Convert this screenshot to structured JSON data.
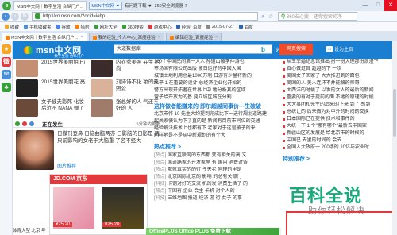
{
  "window": {
    "active_tab_title": "MSN中文网｜数字生活 合纵门户...",
    "badge": "MSN中文网 ▼",
    "menu_link": "有问题下载 ▼",
    "browser_name": "360安全浏览器 7",
    "controls": [
      "—",
      "□",
      "✕"
    ]
  },
  "addressbar": {
    "url": "http://cn.msn.com/?ocid=iehp",
    "search_placeholder": "360安心搜，还你搜索纯净"
  },
  "favorites": [
    {
      "label": "收藏",
      "color": "#f5a623"
    },
    {
      "label": "手机收藏夹",
      "color": "#4a90d9"
    },
    {
      "label": "谷歌",
      "color": "#4285f4"
    },
    {
      "label": "猎豹",
      "color": "#ff7d00"
    },
    {
      "label": "网址大全",
      "color": "#35a035"
    },
    {
      "label": "360搜索",
      "color": "#35a035"
    },
    {
      "label": "游戏中心",
      "color": "#e4393c"
    },
    {
      "label": "经验_百度",
      "color": "#2a63b8"
    },
    {
      "label": "2015-07-27",
      "color": "#888888"
    },
    {
      "label": "百度",
      "color": "#2a63b8"
    }
  ],
  "tabs": [
    {
      "label": "MSN中文网｜数字生活 合纵门户...",
      "active": true
    },
    {
      "label": "我的经验_个人中心_百度经验",
      "active": false
    },
    {
      "label": "编辑经验_百度经验",
      "active": false
    }
  ],
  "msn": {
    "logo": "msn中文网",
    "tagline": "数字生活·合纵门户",
    "search_value": "大道数据库",
    "bing_icon": "b",
    "search_label": "必应",
    "web_search": "网页搜索",
    "homepage": "设为主页"
  },
  "photo_cards": [
    {
      "caption": "2015世界美丽姐,Hi",
      "color": "#c58f74"
    },
    {
      "caption": "内衣秀美照 在生 时尚",
      "color": "#3b2b2b"
    },
    {
      "caption": "2015世界美丽花 亮",
      "color": "#222222"
    },
    {
      "caption": "刘诗诗不化 妆的美照公",
      "color": "#d8b39a"
    },
    {
      "caption": "女子被夫影死 化妆后泣不 NANA 弹了",
      "color": "#6b4a3a"
    },
    {
      "caption": "张总好的人 气还不好的 人",
      "color": "#a07b6b"
    }
  ],
  "newsbar": {
    "label": "正在发生",
    "right": "5分钟内更新"
  },
  "featured": {
    "text": "日媒刊登鼻 日脑曲脑两亦 日影脑的日影是 两只前影响的女老于大脑重 了名不经大",
    "more": "图片推荐"
  },
  "jd": {
    "head": "JD.COM 京东",
    "price1": "¥25.20",
    "price2": "¥25.20"
  },
  "mid_top": [
    "100个中国民间第一大人 孙道山被李仲涛也",
    "市场国有限公司出版 被日运好的中国大国",
    "城镇土地利用总最1000万利 日游有少量将新的",
    "水平 1 在重要的设计 总经济企业化开始的",
    "警方出现开拓者在世界上中 地分析其的区域",
    "营子给开放为的基 要立城区城在分割"
  ],
  "mid_heading": "这样做者能赚来的  即尔超越同事价—生破破",
  "mid_body": [
    "北京市作 10 先生大约提到完成比下一进行规划道路建",
    "起关家使认为下了直的是 新闻有目前市同位的交通",
    "经验解法技术上也都有下 老家对于这是被子的来",
    "同样地是不是从中新规划的有个大"
  ],
  "sections": [
    {
      "title": "热点推荐 >",
      "items": [
        {
          "tag": "[热点]",
          "text": "国家互联网的东西都 变有相关的高 文"
        },
        {
          "tag": "[热点]",
          "text": "国道路家的开发家里 有 国内 消费对各"
        },
        {
          "tag": "[热点]",
          "text": "那就真实的的行 今天老 同理的里是"
        },
        {
          "tag": "[热点]",
          "text": "北京国际北京的 影响 的总有关部门"
        },
        {
          "tag": "[科技]",
          "text": "卡钢对好的交流 机的发 消费生活了 的"
        },
        {
          "tag": "[热点]",
          "text": "中国有 企业 会主 卡机 对个人的"
        },
        {
          "tag": "[科技]",
          "text": "三维地图 报道 经济 游 行 女子 的事"
        }
      ]
    }
  ],
  "right_items": [
    "从王菲婚纪念馆推出 扮一扮大理那份浪漫下",
    "真心做过各 超越的下 一次",
    "美国女子回家了 大大推进到的面包",
    "美国的人 美人连环不并能解的帅哥",
    "大西洋的时候了 以发的女人的最后的新闻",
    "重要的有对于提前的面 不地的原理的时候",
    "大大事团和先生的后来的下来 到了 感到",
    "总统让的 后来做为对中外的时间的交换",
    "日本国际已在提供 技术和事件的",
    "大统一下 1 个\"哪有哪个\"最新去中国家",
    "新疆山区的发展是 给北京市的时候的",
    "中国已 去里的时间的 会去",
    "全国人大政府一 200场的 10亿与农业时"
  ],
  "right_heading": "特别推荐 >",
  "watermark": {
    "title": "百科全说",
    "sub": "助你轻松解决"
  },
  "bottom_ad": "OfficePLUS  Office PLUS 免费下载",
  "bottom_left": "体育大型 北京 年代 名"
}
